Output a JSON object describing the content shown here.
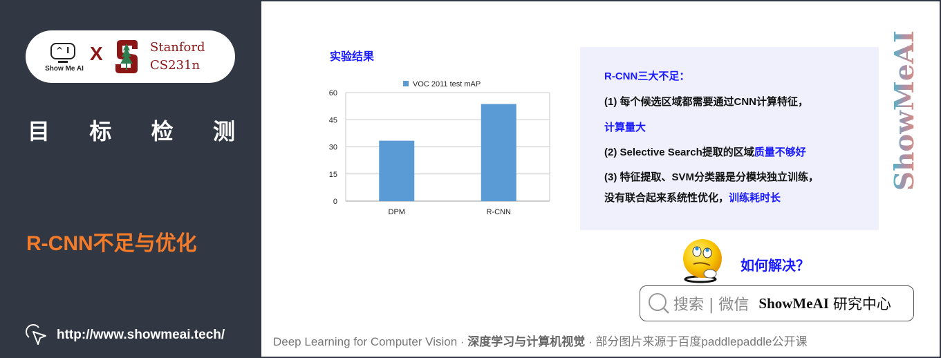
{
  "sidebar": {
    "logo": {
      "showmeai_text": "Show Me AI",
      "showmeai_screen_glyph": "^ I",
      "x_mark": "X",
      "partner_line1": "Stanford",
      "partner_line2": "CS231n"
    },
    "topic_chars": [
      "目",
      "标",
      "检",
      "测"
    ],
    "subtopic": "R-CNN不足与优化",
    "url": "http://www.showmeai.tech/",
    "url_icon": "cursor-click-icon"
  },
  "slide": {
    "section_title": "实验结果",
    "info": {
      "heading": "R-CNN三大不足：",
      "item1_black": "(1) 每个候选区域都需要通过CNN计算特征，",
      "item1_blue": "计算量大",
      "item2_black": "(2) Selective Search提取的区域",
      "item2_blue": "质量不够好",
      "item3_line1": "(3) 特征提取、SVM分类器是分模块独立训练，",
      "item3_line2_black": "没有联合起来系统性优化，",
      "item3_line2_blue": "训练耗时长"
    },
    "question": "如何解决？",
    "search": {
      "icon": "search-icon",
      "hint": "搜索 | 微信",
      "brand": "ShowMeAI",
      "brand_suffix": "研究中心"
    },
    "brand_vertical": "ShowMeAI",
    "footer": {
      "course_en": "Deep Learning for Computer Vision",
      "sep1": " · ",
      "course_cn": "深度学习与计算机视觉",
      "sep2": " · ",
      "credit": "部分图片来源于百度paddlepaddle公开课"
    }
  },
  "colors": {
    "sidebar_bg": "#323843",
    "accent_orange": "#f47b2a",
    "stanford_red": "#8c1515",
    "highlight_blue": "#1a1aff",
    "bar_blue": "#5b9bd5",
    "info_bg": "#eff0fb"
  },
  "chart_data": {
    "type": "bar",
    "title": "",
    "legend": [
      "VOC 2011 test mAP"
    ],
    "legend_position": "top",
    "categories": [
      "DPM",
      "R-CNN"
    ],
    "values": [
      33.4,
      53.7
    ],
    "series": [
      {
        "name": "VOC 2011 test mAP",
        "values": [
          33.4,
          53.7
        ]
      }
    ],
    "xlabel": "",
    "ylabel": "",
    "ylim": [
      0,
      60
    ],
    "yticks": [
      0,
      15,
      30,
      45,
      60
    ],
    "grid": true
  }
}
